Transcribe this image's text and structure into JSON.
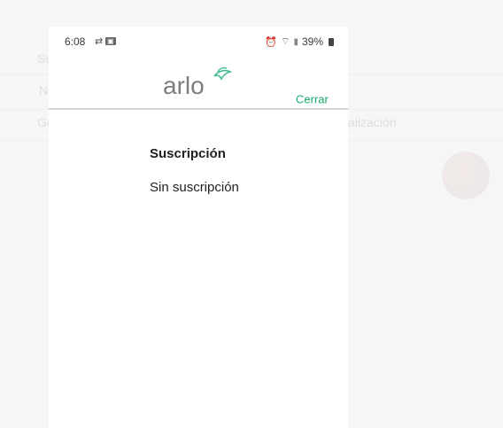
{
  "status_bar": {
    "time": "6:08",
    "battery": "39%",
    "icons": [
      "refresh-icon",
      "notification-icon",
      "alarm-icon",
      "wifi-icon",
      "signal-icon",
      "battery-icon"
    ]
  },
  "header": {
    "logo_text": "arlo",
    "close_label": "Cerrar"
  },
  "content": {
    "section_title": "Suscripción",
    "section_value": "Sin suscripción"
  },
  "background": {
    "left_texts": [
      "Su",
      "Nc",
      "Ge"
    ],
    "right_text": "alización"
  },
  "colors": {
    "accent": "#1aaa6c",
    "logo_gray": "#7b7d80",
    "logo_green": "#3dbb8f"
  }
}
